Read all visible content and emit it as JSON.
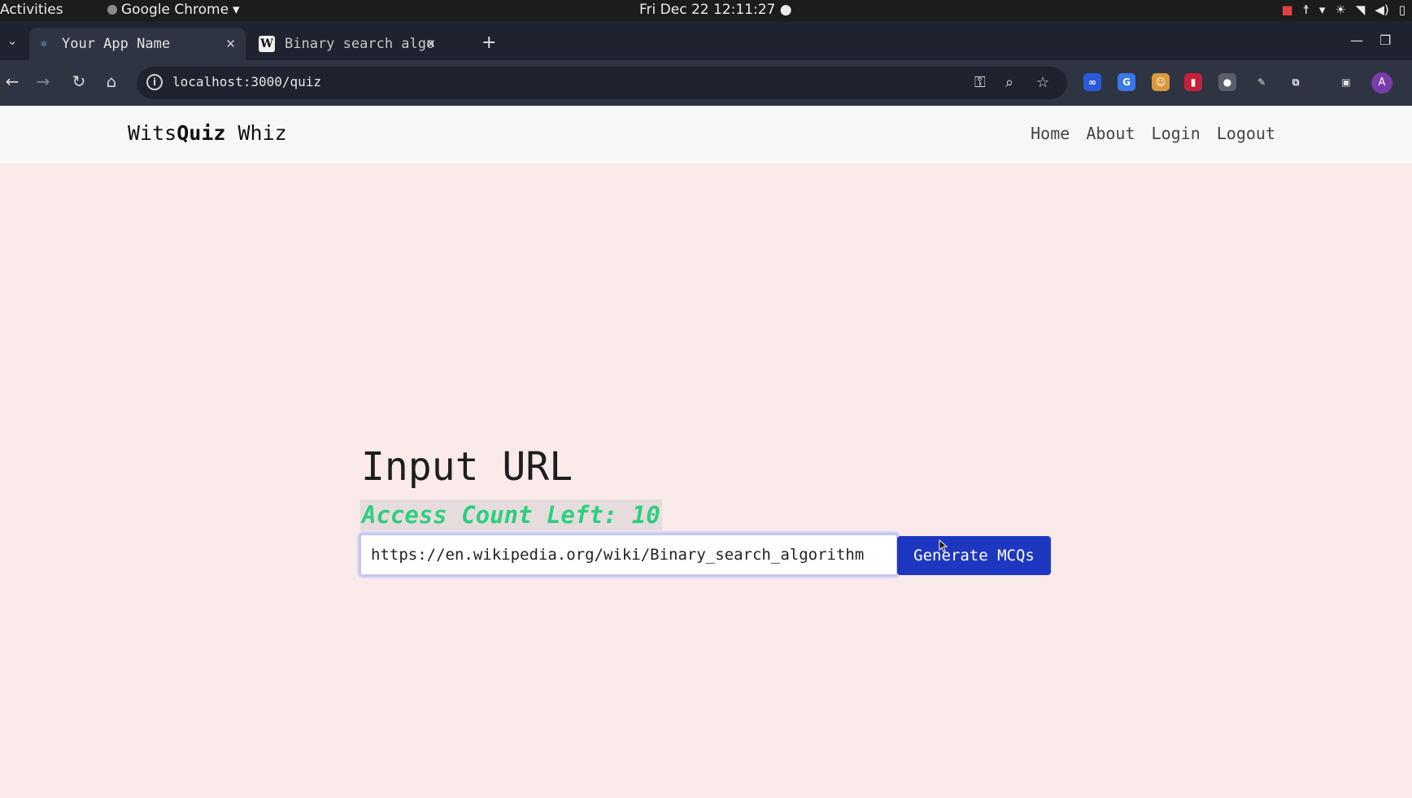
{
  "system_bar": {
    "activities": "Activities",
    "app_name": "Google Chrome",
    "clock": "Fri Dec 22  12:11:27"
  },
  "browser": {
    "tabs": [
      {
        "title": "Your App Name",
        "favicon": "react-icon",
        "active": true
      },
      {
        "title": "Binary search algo",
        "favicon": "wikipedia-icon",
        "active": false
      }
    ],
    "address": "localhost:3000/quiz",
    "profile_initial": "A"
  },
  "site": {
    "brand_prefix": "Wits",
    "brand_bold": "Quiz",
    "brand_suffix": " Whiz",
    "nav": [
      "Home",
      "About",
      "Login",
      "Logout"
    ]
  },
  "main": {
    "heading": "Input URL",
    "access_count": "Access Count Left: 10",
    "url_value": "https://en.wikipedia.org/wiki/Binary_search_algorithm",
    "generate_label": "Generate MCQs"
  },
  "colors": {
    "accent_button": "#1e37c0",
    "access_text": "#2ecf7e",
    "page_background": "#fbeaea"
  }
}
